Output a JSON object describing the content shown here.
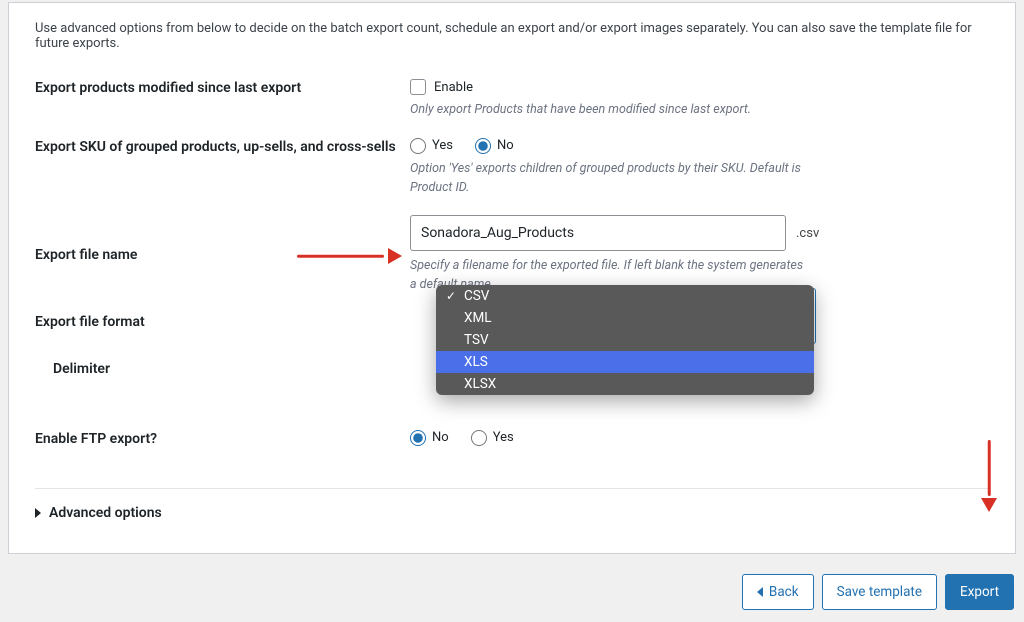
{
  "intro": "Use advanced options from below to decide on the batch export count, schedule an export and/or export images separately. You can also save the template file for future exports.",
  "rows": {
    "modified": {
      "label": "Export products modified since last export",
      "checkbox_label": "Enable",
      "helper": "Only export Products that have been modified since last export."
    },
    "sku": {
      "label": "Export SKU of grouped products, up-sells, and cross-sells",
      "yes": "Yes",
      "no": "No",
      "helper": "Option 'Yes' exports children of grouped products by their SKU. Default is Product ID."
    },
    "filename": {
      "label": "Export file name",
      "value": "Sonadora_Aug_Products",
      "ext": ".csv",
      "helper": "Specify a filename for the exported file. If left blank the system generates a default name."
    },
    "format": {
      "label": "Export file format"
    },
    "delimiter": {
      "label": "Delimiter"
    },
    "ftp": {
      "label": "Enable FTP export?",
      "no": "No",
      "yes": "Yes"
    },
    "advanced": {
      "label": "Advanced options"
    }
  },
  "dropdown": {
    "options": [
      "CSV",
      "XML",
      "TSV",
      "XLS",
      "XLSX"
    ],
    "checked": "CSV",
    "highlighted": "XLS"
  },
  "footer": {
    "back": "Back",
    "save": "Save template",
    "export": "Export"
  }
}
